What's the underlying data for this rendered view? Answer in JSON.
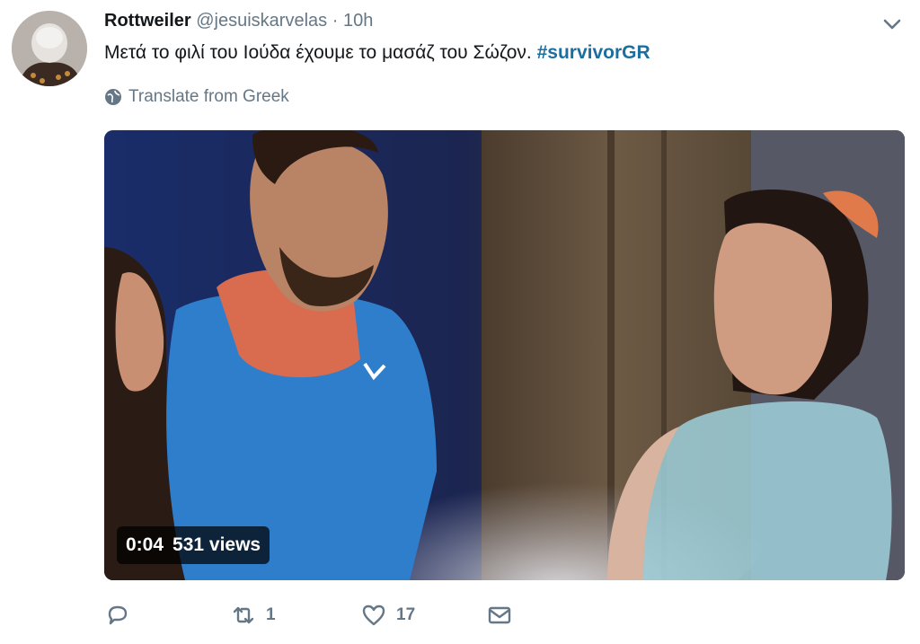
{
  "tweet": {
    "display_name": "Rottweiler",
    "handle": "@jesuiskarvelas",
    "separator": "·",
    "time": "10h",
    "text": "Μετά το φιλί του Ιούδα έχουμε το μασάζ του Σώζον. ",
    "hashtag": "#survivorGR",
    "translate_label": "Translate from Greek"
  },
  "video": {
    "duration": "0:04",
    "views": "531 views"
  },
  "actions": {
    "reply_icon": "reply-icon",
    "retweet_icon": "retweet-icon",
    "retweet_count": "1",
    "like_icon": "heart-icon",
    "like_count": "17",
    "dm_icon": "envelope-icon"
  },
  "colors": {
    "hashtag": "#1b6fa0",
    "muted": "#657786",
    "text": "#14171a"
  }
}
